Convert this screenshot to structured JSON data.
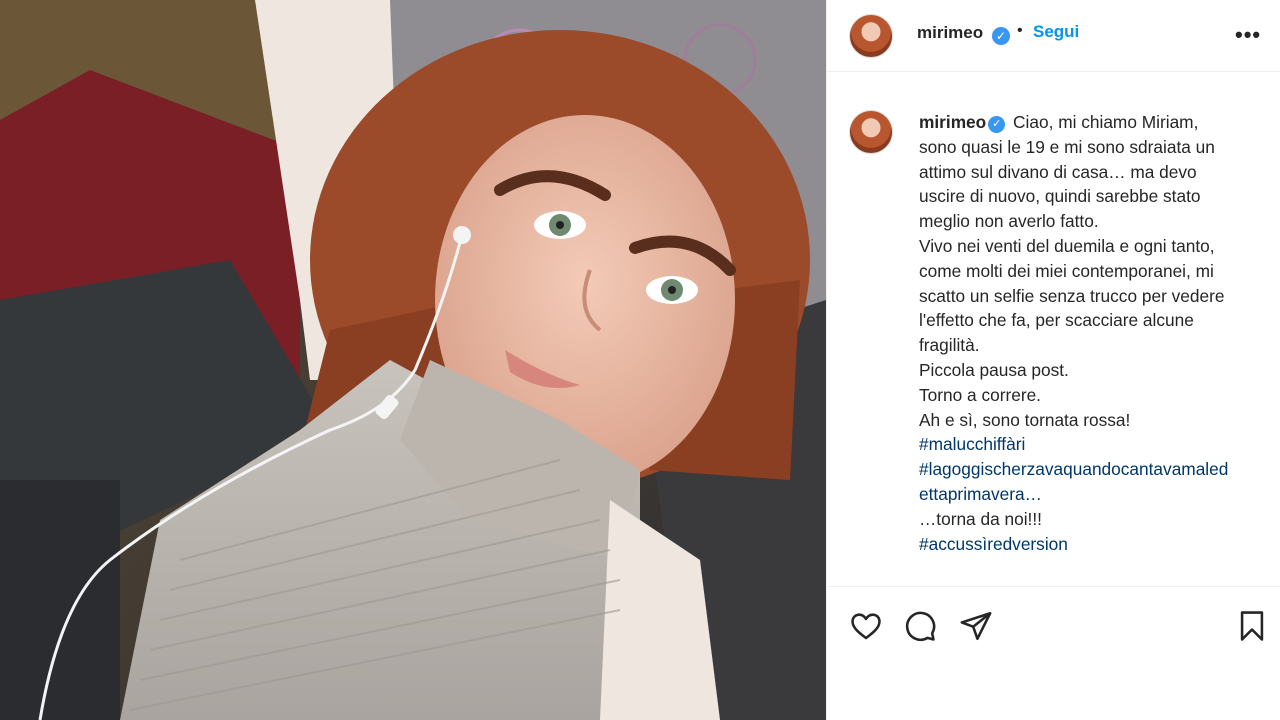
{
  "post": {
    "username": "mirimeo",
    "verified_glyph": "✓",
    "separator": "•",
    "follow_label": "Segui",
    "more_label": "•••",
    "caption_lines": [
      "sono quasi le 19 e mi sono sdraiata un",
      "attimo sul divano di casa… ma devo",
      "uscire di nuovo, quindi sarebbe stato",
      "meglio non averlo fatto.",
      "Vivo nei venti del duemila e ogni tanto,",
      "come molti dei miei contemporanei, mi",
      "scatto un selfie senza trucco per vedere",
      "l'effetto che fa, per scacciare alcune",
      "fragilità.",
      "Piccola pausa post.",
      "Torno a correre.",
      "Ah e sì, sono tornata rossa!"
    ],
    "caption_first": "Ciao, mi chiamo Miriam,",
    "hashtag_1": "#malucchiffàri",
    "hashtag_2_line1": "#lagoggischerzavaquandocantavamaled",
    "hashtag_2_line2": "ettaprimavera…",
    "after_tag": "…torna da noi!!!",
    "hashtag_3": "#accussìredversion"
  },
  "icons": {
    "like": "heart-icon",
    "comment": "comment-icon",
    "share": "send-icon",
    "save": "bookmark-icon"
  },
  "colors": {
    "accent": "#0095f6",
    "hashtag": "#00376b",
    "verified": "#3897f0"
  }
}
